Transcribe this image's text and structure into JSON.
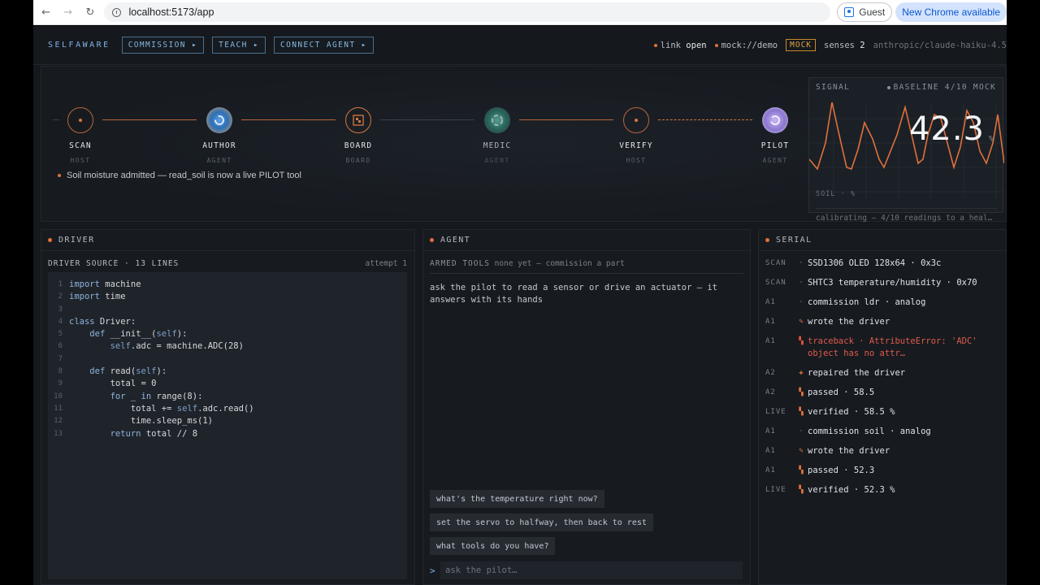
{
  "browser": {
    "url": "localhost:5173/app",
    "profile": "Guest",
    "update": "New Chrome available"
  },
  "topbar": {
    "brand": "SELFAWARE",
    "menus": [
      "COMMISSION ▸",
      "TEACH ▸",
      "CONNECT AGENT ▸"
    ],
    "link_label": "link",
    "link_value": "open",
    "mock_source": "mock://demo",
    "mock_badge": "MOCK",
    "senses_label": "senses",
    "senses_value": "2",
    "model": "anthropic/claude-haiku-4.5"
  },
  "pipeline": {
    "steps": [
      {
        "name": "SCAN",
        "type": "HOST"
      },
      {
        "name": "AUTHOR",
        "type": "AGENT"
      },
      {
        "name": "BOARD",
        "type": "BOARD"
      },
      {
        "name": "MEDIC",
        "type": "AGENT"
      },
      {
        "name": "VERIFY",
        "type": "HOST"
      },
      {
        "name": "PILOT",
        "type": "AGENT"
      }
    ],
    "status": "Soil moisture admitted — read_soil is now a live PILOT tool"
  },
  "signal": {
    "title": "SIGNAL",
    "baseline": "BASELINE 4/10",
    "mode": "MOCK",
    "value": "42.3",
    "unit": "%",
    "axis": "SOIL · %",
    "calibrating": "calibrating — 4/10 readings to a heal…"
  },
  "driver": {
    "title": "DRIVER",
    "source_label": "DRIVER SOURCE · 13 LINES",
    "attempt": "attempt 1",
    "lines": [
      "import machine",
      "import time",
      "",
      "class Driver:",
      "    def __init__(self):",
      "        self.adc = machine.ADC(28)",
      "",
      "    def read(self):",
      "        total = 0",
      "        for _ in range(8):",
      "            total += self.adc.read()",
      "            time.sleep_ms(1)",
      "        return total // 8"
    ]
  },
  "agent": {
    "title": "AGENT",
    "armed_label": "ARMED TOOLS",
    "armed_value": "none yet — commission a part",
    "message": "ask the pilot to read a sensor or drive an actuator — it answers with its hands",
    "suggestions": [
      "what's the temperature right now?",
      "set the servo to halfway, then back to rest",
      "what tools do you have?"
    ],
    "prompt_caret": ">",
    "input_placeholder": "ask the pilot…"
  },
  "serial": {
    "title": "SERIAL",
    "rows": [
      {
        "tag": "SCAN",
        "icon": "·",
        "kind": "dot",
        "msg": "SSD1306 OLED 128x64 · 0x3c"
      },
      {
        "tag": "SCAN",
        "icon": "·",
        "kind": "dot",
        "msg": "SHTC3 temperature/humidity · 0x70"
      },
      {
        "tag": "A1",
        "icon": "·",
        "kind": "dot",
        "msg": "commission ldr · analog"
      },
      {
        "tag": "A1",
        "icon": "✎",
        "kind": "pen",
        "msg": "wrote the driver"
      },
      {
        "tag": "A1",
        "icon": "▚",
        "kind": "err",
        "msg": "traceback · AttributeError: 'ADC' object has no attr…"
      },
      {
        "tag": "A2",
        "icon": "✚",
        "kind": "plus",
        "msg": "repaired the driver"
      },
      {
        "tag": "A2",
        "icon": "▚",
        "kind": "ok",
        "msg": "passed · 58.5"
      },
      {
        "tag": "LIVE",
        "icon": "▚",
        "kind": "ok",
        "msg": "verified · 58.5 %"
      },
      {
        "tag": "A1",
        "icon": "·",
        "kind": "dot",
        "msg": "commission soil · analog"
      },
      {
        "tag": "A1",
        "icon": "✎",
        "kind": "pen",
        "msg": "wrote the driver"
      },
      {
        "tag": "A1",
        "icon": "▚",
        "kind": "ok",
        "msg": "passed · 52.3"
      },
      {
        "tag": "LIVE",
        "icon": "▚",
        "kind": "ok",
        "msg": "verified · 52.3 %"
      }
    ]
  },
  "colors": {
    "accent": "#e0703a",
    "link_blue": "#7fb4e8",
    "error": "#e05a4a",
    "background": "#15181c"
  }
}
